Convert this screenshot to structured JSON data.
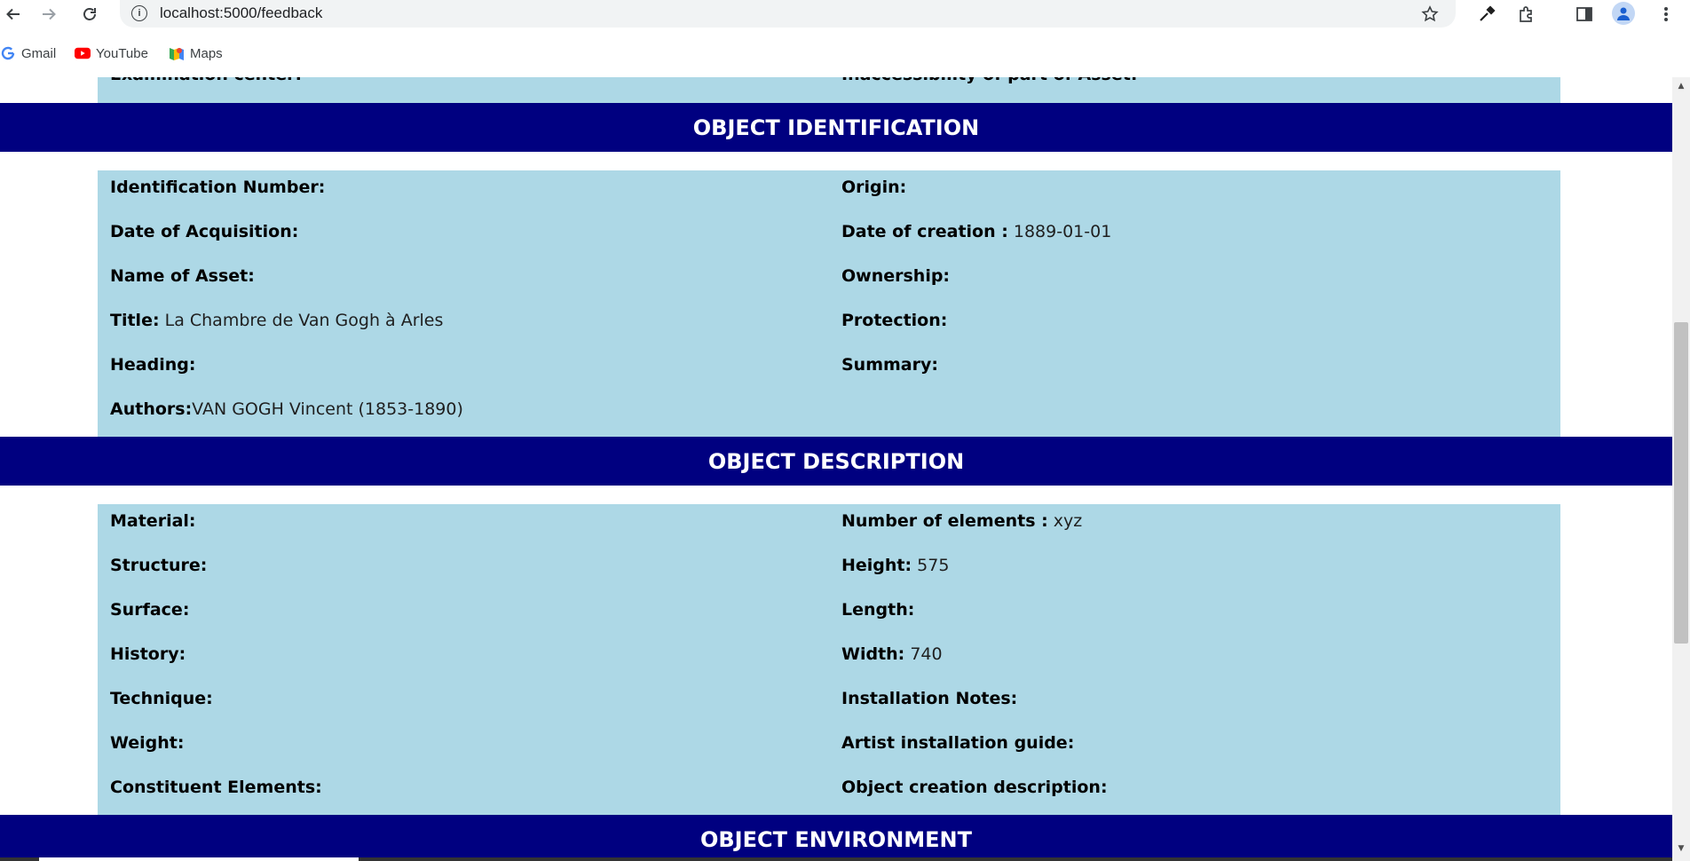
{
  "browser": {
    "url": "localhost:5000/feedback",
    "bookmarks": [
      "Gmail",
      "YouTube",
      "Maps"
    ]
  },
  "page": {
    "partial_fields": {
      "left": "Examination center:",
      "right": "Inaccessibility of part of Asset:"
    },
    "sections": [
      {
        "title": "OBJECT IDENTIFICATION",
        "left": [
          {
            "label": "Identification Number:",
            "value": ""
          },
          {
            "label": "Date of Acquisition:",
            "value": ""
          },
          {
            "label": "Name of Asset:",
            "value": ""
          },
          {
            "label": "Title:",
            "value": " La Chambre de Van Gogh à Arles"
          },
          {
            "label": "Heading:",
            "value": ""
          },
          {
            "label": "Authors:",
            "value": "VAN GOGH Vincent (1853-1890)"
          }
        ],
        "right": [
          {
            "label": "Origin:",
            "value": ""
          },
          {
            "label": "Date of creation :",
            "value": " 1889-01-01"
          },
          {
            "label": "Ownership:",
            "value": ""
          },
          {
            "label": "Protection:",
            "value": ""
          },
          {
            "label": "Summary:",
            "value": ""
          }
        ]
      },
      {
        "title": "OBJECT DESCRIPTION",
        "left": [
          {
            "label": "Material:",
            "value": ""
          },
          {
            "label": "Structure:",
            "value": ""
          },
          {
            "label": "Surface:",
            "value": ""
          },
          {
            "label": "History:",
            "value": ""
          },
          {
            "label": "Technique:",
            "value": ""
          },
          {
            "label": "Weight:",
            "value": ""
          },
          {
            "label": "Constituent Elements:",
            "value": ""
          }
        ],
        "right": [
          {
            "label": "Number of elements :",
            "value": " xyz"
          },
          {
            "label": "Height:",
            "value": " 575"
          },
          {
            "label": "Length:",
            "value": ""
          },
          {
            "label": "Width:",
            "value": " 740"
          },
          {
            "label": "Installation Notes:",
            "value": ""
          },
          {
            "label": "Artist installation guide:",
            "value": ""
          },
          {
            "label": "Object creation description:",
            "value": ""
          }
        ]
      },
      {
        "title": "OBJECT ENVIRONMENT",
        "left": [],
        "right": []
      }
    ]
  },
  "colors": {
    "header_bg": "#000080",
    "panel_bg": "#add8e6"
  }
}
